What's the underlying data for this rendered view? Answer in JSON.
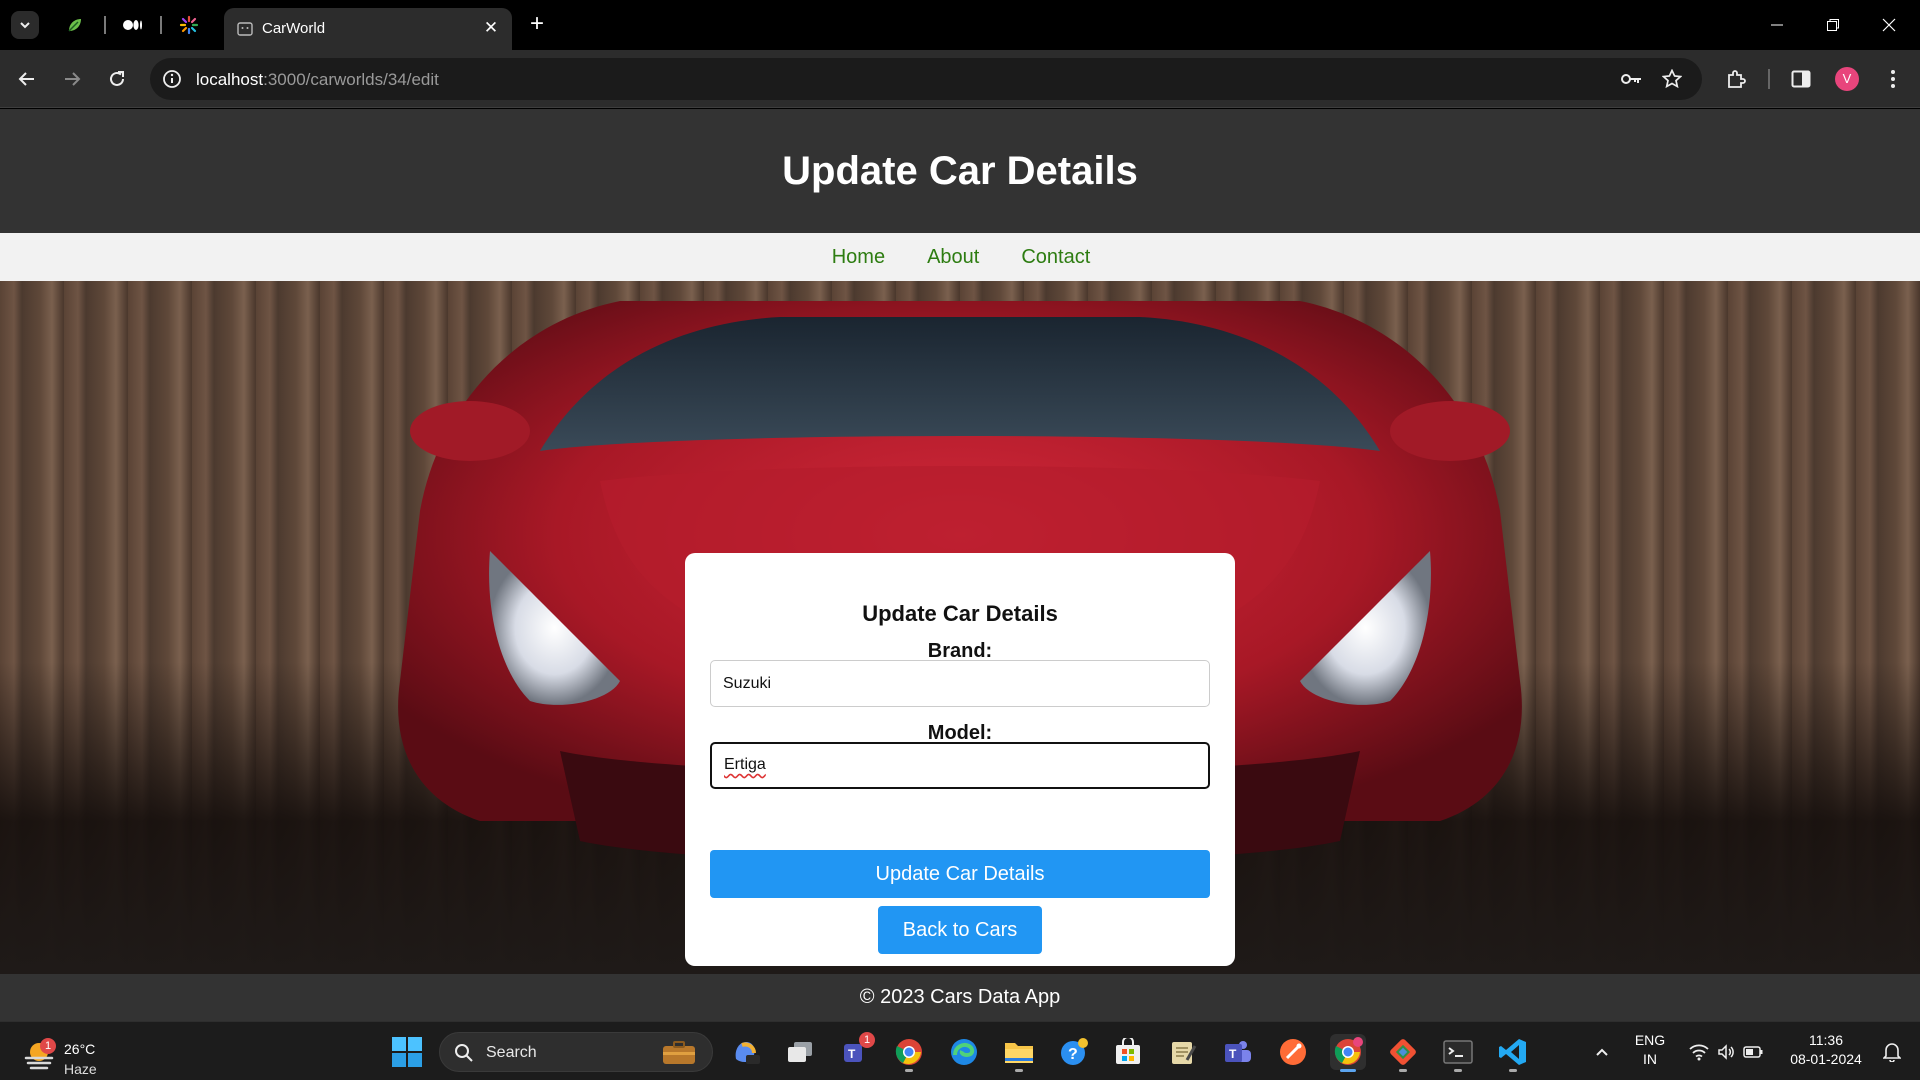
{
  "browser": {
    "tab_title": "CarWorld",
    "url_host": "localhost",
    "url_path": ":3000/carworlds/34/edit",
    "profile_initial": "V"
  },
  "page": {
    "header_title": "Update Car Details",
    "nav": [
      "Home",
      "About",
      "Contact"
    ],
    "form": {
      "title": "Update Car Details",
      "brand_label": "Brand:",
      "brand_value": "Suzuki",
      "model_label": "Model:",
      "model_value": "Ertiga",
      "submit_label": "Update Car Details",
      "back_label": "Back to Cars"
    },
    "footer": "© 2023 Cars Data App"
  },
  "taskbar": {
    "weather_temp": "26°C",
    "weather_condition": "Haze",
    "weather_badge": "1",
    "search_label": "Search",
    "teams_badge": "1",
    "language": "ENG",
    "region": "IN",
    "time": "11:36",
    "date": "08-01-2024"
  },
  "colors": {
    "header_bg": "#333333",
    "nav_link": "#2e7d12",
    "button_blue": "#2196f3",
    "car_red": "#b81c2a"
  }
}
